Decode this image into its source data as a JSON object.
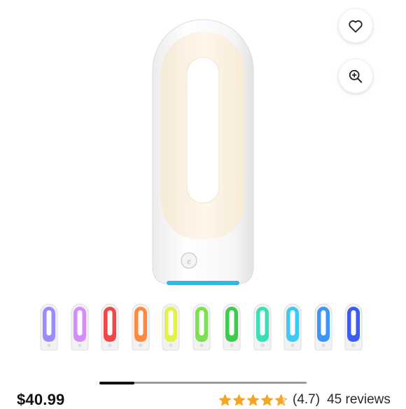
{
  "product": {
    "price": "$40.99",
    "rating_display": "(4.7)",
    "rating_value": 4.7,
    "reviews_label": "45 reviews"
  },
  "icons": {
    "favorite": "heart-icon",
    "zoom": "zoom-in-icon",
    "star": "star-icon"
  },
  "thumbnail_colors": [
    "#9a8cff",
    "#d58cff",
    "#f04848",
    "#ff8a3d",
    "#e4f04a",
    "#7de04f",
    "#3ecb4e",
    "#37e0b5",
    "#3cc9f2",
    "#3d95f5",
    "#3d5bf0"
  ],
  "carousel": {
    "progress": 0.17
  },
  "colors": {
    "star": "#f5a623",
    "device_base": "#33b6e6"
  }
}
